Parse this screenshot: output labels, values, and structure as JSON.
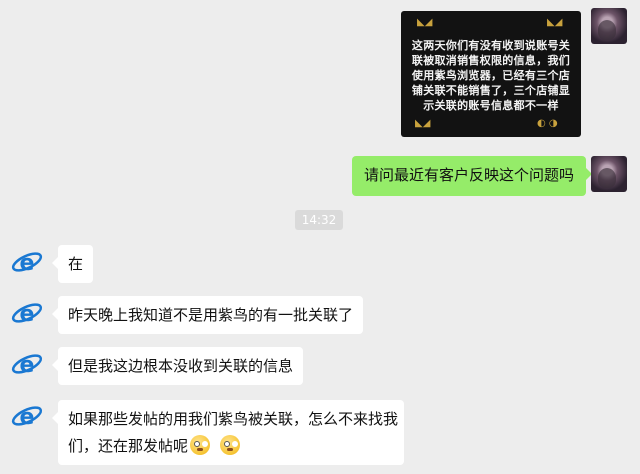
{
  "image_message": {
    "text": "这两天你们有没有收到说账号关联被取消销售权限的信息，我们使用紫鸟浏览器，已经有三个店铺关联不能销售了，三个店铺显示关联的账号信息都不一样"
  },
  "outgoing_message": {
    "text": "请问最近有客户反映这个问题吗"
  },
  "timestamp": "14:32",
  "incoming_messages": [
    {
      "text": "在"
    },
    {
      "text": "昨天晚上我知道不是用紫鸟的有一批关联了"
    },
    {
      "text": "但是我这边根本没收到关联的信息"
    },
    {
      "line1": "如果那些发帖的用我们紫鸟被关联，怎么不来找我",
      "line2": "们，还在那发帖呢"
    }
  ],
  "icons": {
    "contact_avatar": "ie-logo-icon",
    "self_avatar": "profile-photo",
    "emoji": "dizzy-face-emoji"
  },
  "colors": {
    "background": "#ededed",
    "outgoing_bubble": "#95ec69",
    "incoming_bubble": "#ffffff",
    "contact_avatar_blue": "#1a78d2"
  }
}
